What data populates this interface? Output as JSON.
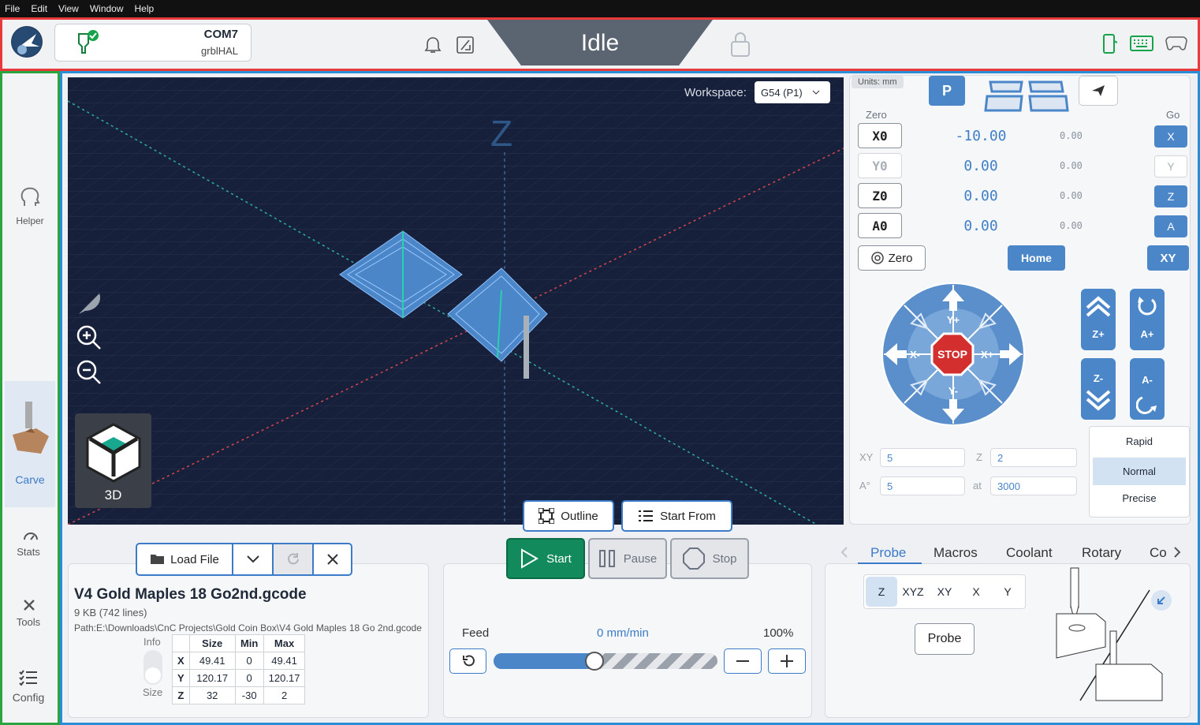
{
  "menu": [
    "File",
    "Edit",
    "View",
    "Window",
    "Help"
  ],
  "connection": {
    "port": "COM7",
    "firmware": "grblHAL"
  },
  "status": "Idle",
  "nav": {
    "helper": "Helper",
    "carve": "Carve",
    "stats": "Stats",
    "tools": "Tools",
    "config": "Config"
  },
  "viewport": {
    "workspace_label": "Workspace:",
    "workspace_value": "G54 (P1)",
    "z_label": "Z",
    "view_label": "3D"
  },
  "dro": {
    "units": "Units: mm",
    "zero_header": "Zero",
    "go_header": "Go",
    "p_label": "P",
    "axes": [
      {
        "zero": "X0",
        "value": "-10.00",
        "machine": "0.00",
        "go": "X"
      },
      {
        "zero": "Y0",
        "value": "0.00",
        "machine": "0.00",
        "go": "Y"
      },
      {
        "zero": "Z0",
        "value": "0.00",
        "machine": "0.00",
        "go": "Z"
      },
      {
        "zero": "A0",
        "value": "0.00",
        "machine": "0.00",
        "go": "A"
      }
    ],
    "zero_btn": "Zero",
    "home_btn": "Home",
    "xy_btn": "XY"
  },
  "jog": {
    "yplus": "Y+",
    "yminus": "Y-",
    "xplus": "X+",
    "xminus": "X-",
    "stop": "STOP",
    "zplus": "Z+",
    "zminus": "Z-",
    "aplus": "A+",
    "aminus": "A-",
    "xy_label": "XY",
    "xy_value": "5",
    "z_label": "Z",
    "z_value": "2",
    "a_label": "A°",
    "a_value": "5",
    "at_label": "at",
    "at_value": "3000",
    "speeds": [
      "Rapid",
      "Normal",
      "Precise"
    ],
    "selected_speed": "Normal"
  },
  "job": {
    "outline": "Outline",
    "start_from": "Start From",
    "start": "Start",
    "pause": "Pause",
    "stop": "Stop",
    "feed_label": "Feed",
    "feed_value": "0 mm/min",
    "feed_pct": "100%",
    "feed_slider": 0.45
  },
  "file": {
    "load": "Load File",
    "name": "V4 Gold Maples 18 Go2nd.gcode",
    "size": "9 KB (742 lines)",
    "path": "Path:E:\\Downloads\\CnC Projects\\Gold Coin Box\\V4 Gold Maples 18 Go 2nd.gcode",
    "info_label": "Info",
    "size_label": "Size",
    "table": {
      "headers": [
        "",
        "Size",
        "Min",
        "Max"
      ],
      "rows": [
        [
          "X",
          "49.41",
          "0",
          "49.41"
        ],
        [
          "Y",
          "120.17",
          "0",
          "120.17"
        ],
        [
          "Z",
          "32",
          "-30",
          "2"
        ]
      ]
    }
  },
  "tools": {
    "tabs": [
      "Probe",
      "Macros",
      "Coolant",
      "Rotary",
      "Co"
    ],
    "probe_axes": [
      "Z",
      "XYZ",
      "XY",
      "X",
      "Y"
    ],
    "probe_btn": "Probe"
  },
  "colors": {
    "accent": "#4a86c8",
    "start": "#128a5c",
    "topbar_border": "#e83a3a",
    "nav_border": "#2aa43f",
    "main_border": "#2a8ed6"
  }
}
